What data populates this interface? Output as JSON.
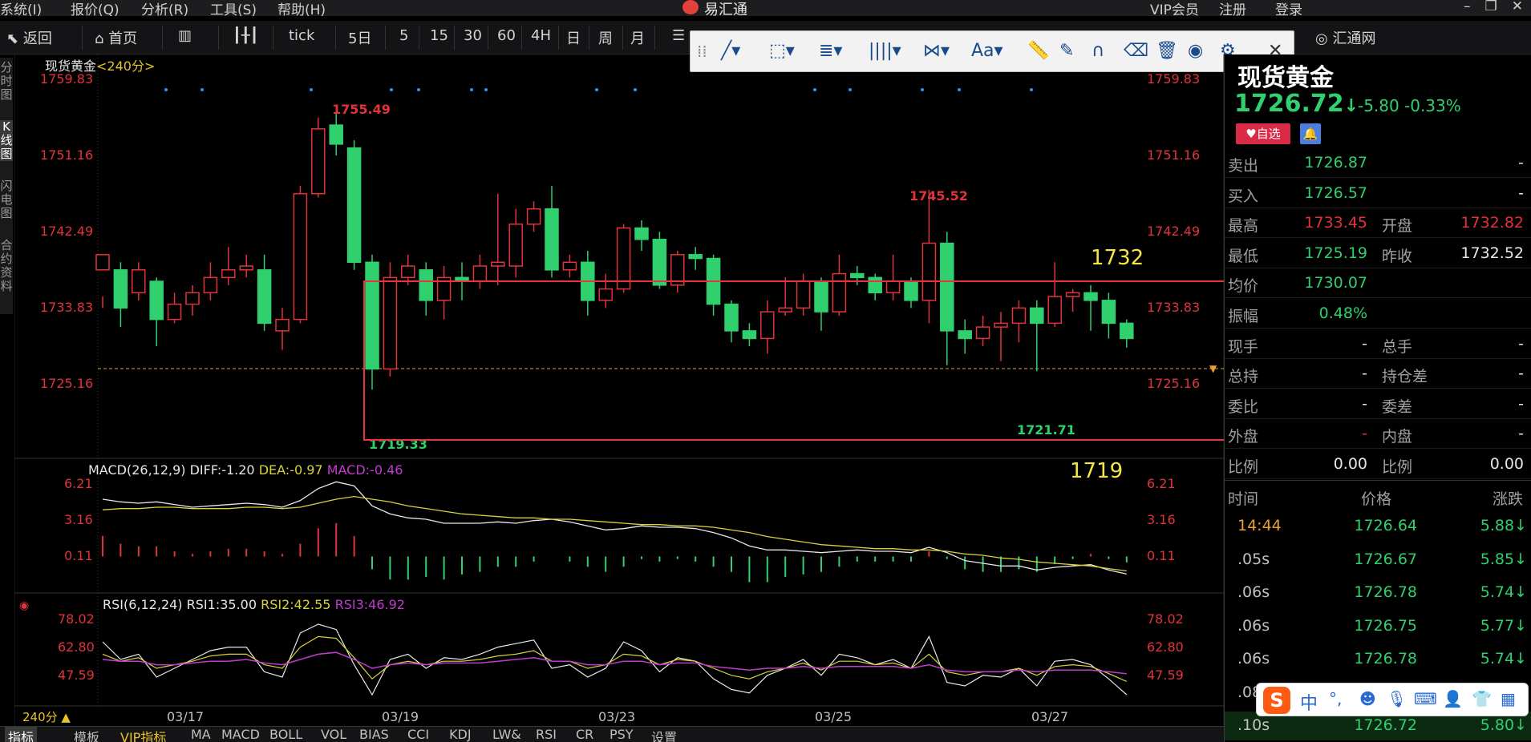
{
  "menubar": {
    "items": [
      "系统(I)",
      "报价(Q)",
      "分析(R)",
      "工具(S)",
      "帮助(H)"
    ],
    "app_title": "易汇通",
    "user_links": [
      "VIP会员",
      "注册",
      "登录"
    ]
  },
  "toolbar": {
    "back": "返回",
    "home": "首页",
    "tick": "tick",
    "periods": [
      "5日",
      "5",
      "15",
      "30",
      "60",
      "4H",
      "日",
      "周",
      "月"
    ],
    "brand": "汇通网"
  },
  "side_tabs": [
    "分时图",
    "K线图",
    "闪电图",
    "合约资料"
  ],
  "chart": {
    "instrument_label": "现货黄金",
    "period_label": "<240分>",
    "price_levels": [
      "1759.83",
      "1751.16",
      "1742.49",
      "1733.83",
      "1725.16"
    ],
    "annotations": {
      "high_label": "1755.49",
      "mid_high_label": "1745.52",
      "low_label": "1719.33",
      "low2_label": "1721.71",
      "note_upper": "1732",
      "note_lower": "1719"
    },
    "macd_header": {
      "title": "MACD(26,12,9)",
      "diff": "DIFF:-1.20",
      "dea": "DEA:-0.97",
      "macd": "MACD:-0.46"
    },
    "macd_levels": [
      "6.21",
      "3.16",
      "0.11"
    ],
    "rsi_header": {
      "title": "RSI(6,12,24)",
      "rsi1": "RSI1:35.00",
      "rsi2": "RSI2:42.55",
      "rsi3": "RSI3:46.92"
    },
    "rsi_levels": [
      "78.02",
      "62.80",
      "47.59"
    ],
    "date_labels": [
      "03/17",
      "03/19",
      "03/23",
      "03/25",
      "03/27"
    ],
    "period_badge": "240分 ▲",
    "colors": {
      "up": "#e0333a",
      "down": "#2fd06d",
      "diff_line": "#e8e8e8",
      "dea_line": "#d8d23a",
      "rsi3_line": "#c23ad0",
      "box": "#e8343f",
      "note": "#f5e642"
    }
  },
  "chart_data": {
    "type": "candlestick",
    "title": "现货黄金",
    "ylim": [
      1717,
      1762
    ],
    "candles": [
      [
        1735.0,
        1737.0,
        1731.5,
        1730.0
      ],
      [
        1735.0,
        1730.0,
        1736.0,
        1727.5
      ],
      [
        1732.0,
        1735.0,
        1736.0,
        1731.0
      ],
      [
        1733.5,
        1728.5,
        1734.0,
        1725.0
      ],
      [
        1728.5,
        1730.5,
        1732.0,
        1728.0
      ],
      [
        1730.5,
        1732.0,
        1733.0,
        1729.0
      ],
      [
        1732.0,
        1734.0,
        1736.0,
        1731.0
      ],
      [
        1734.0,
        1735.0,
        1738.0,
        1733.0
      ],
      [
        1735.0,
        1735.5,
        1737.0,
        1734.0
      ],
      [
        1735.0,
        1728.0,
        1737.0,
        1727.0
      ],
      [
        1727.0,
        1728.5,
        1730.0,
        1724.5
      ],
      [
        1728.5,
        1745.0,
        1746.0,
        1728.0
      ],
      [
        1745.0,
        1753.5,
        1755.0,
        1744.5
      ],
      [
        1754.0,
        1751.5,
        1755.5,
        1750.0
      ],
      [
        1751.0,
        1736.0,
        1752.0,
        1735.0
      ],
      [
        1736.0,
        1722.0,
        1737.0,
        1719.3
      ],
      [
        1722.0,
        1734.0,
        1736.0,
        1721.0
      ],
      [
        1734.0,
        1735.5,
        1737.0,
        1733.0
      ],
      [
        1735.0,
        1731.0,
        1736.0,
        1729.0
      ],
      [
        1731.0,
        1734.0,
        1735.5,
        1728.5
      ],
      [
        1734.0,
        1733.5,
        1736.0,
        1731.0
      ],
      [
        1733.5,
        1735.5,
        1737.0,
        1732.5
      ],
      [
        1735.5,
        1736.0,
        1745.0,
        1733.0
      ],
      [
        1735.5,
        1741.0,
        1743.0,
        1734.0
      ],
      [
        1741.0,
        1743.0,
        1744.0,
        1740.0
      ],
      [
        1743.0,
        1735.0,
        1746.0,
        1734.0
      ],
      [
        1735.0,
        1736.0,
        1737.0,
        1734.0
      ],
      [
        1736.0,
        1731.0,
        1737.5,
        1729.0
      ],
      [
        1731.0,
        1732.5,
        1734.5,
        1730.0
      ],
      [
        1732.5,
        1740.5,
        1741.0,
        1732.0
      ],
      [
        1740.5,
        1739.0,
        1741.5,
        1737.5
      ],
      [
        1739.0,
        1733.0,
        1740.0,
        1732.5
      ],
      [
        1733.0,
        1737.0,
        1737.5,
        1732.0
      ],
      [
        1737.0,
        1736.5,
        1738.0,
        1735.0
      ],
      [
        1736.5,
        1730.5,
        1737.0,
        1729.0
      ],
      [
        1730.5,
        1727.0,
        1731.0,
        1725.5
      ],
      [
        1727.0,
        1726.0,
        1728.0,
        1725.0
      ],
      [
        1726.0,
        1729.5,
        1731.0,
        1724.0
      ],
      [
        1729.5,
        1730.0,
        1734.0,
        1729.0
      ],
      [
        1730.0,
        1733.5,
        1734.5,
        1729.0
      ],
      [
        1733.5,
        1729.5,
        1734.0,
        1727.0
      ],
      [
        1729.5,
        1734.5,
        1737.0,
        1729.0
      ],
      [
        1734.5,
        1734.0,
        1735.5,
        1733.0
      ],
      [
        1734.0,
        1732.0,
        1734.5,
        1731.0
      ],
      [
        1732.0,
        1733.5,
        1737.0,
        1731.0
      ],
      [
        1733.5,
        1731.0,
        1734.0,
        1730.0
      ],
      [
        1731.0,
        1738.5,
        1745.5,
        1728.0
      ],
      [
        1738.5,
        1727.0,
        1740.0,
        1722.5
      ],
      [
        1727.0,
        1726.0,
        1728.5,
        1724.0
      ],
      [
        1726.0,
        1727.5,
        1729.0,
        1725.0
      ],
      [
        1727.5,
        1728.0,
        1729.5,
        1723.0
      ],
      [
        1728.0,
        1730.0,
        1731.0,
        1725.5
      ],
      [
        1730.0,
        1728.0,
        1731.0,
        1721.7
      ],
      [
        1728.0,
        1731.5,
        1736.0,
        1727.5
      ],
      [
        1731.5,
        1732.0,
        1732.5,
        1729.5
      ],
      [
        1732.0,
        1731.0,
        1733.0,
        1727.0
      ],
      [
        1731.0,
        1728.0,
        1732.0,
        1726.0
      ],
      [
        1728.0,
        1726.0,
        1728.5,
        1724.8
      ]
    ],
    "macd": {
      "diff": [
        4.4,
        4.2,
        4.1,
        4.2,
        4.0,
        3.8,
        3.9,
        4.0,
        4.1,
        4.0,
        3.8,
        4.3,
        5.2,
        5.7,
        5.4,
        3.9,
        3.3,
        3.0,
        2.9,
        2.6,
        2.6,
        2.6,
        2.7,
        2.6,
        2.8,
        2.9,
        2.7,
        2.4,
        2.1,
        2.2,
        2.4,
        2.3,
        2.3,
        2.2,
        1.9,
        1.5,
        0.9,
        0.6,
        0.6,
        0.5,
        0.4,
        0.5,
        0.6,
        0.5,
        0.5,
        0.4,
        0.8,
        0.4,
        -0.2,
        -0.4,
        -0.6,
        -0.6,
        -0.9,
        -0.7,
        -0.6,
        -0.5,
        -0.9,
        -1.2
      ],
      "dea": [
        3.6,
        3.7,
        3.7,
        3.8,
        3.8,
        3.7,
        3.7,
        3.7,
        3.8,
        3.8,
        3.7,
        3.8,
        4.1,
        4.4,
        4.6,
        4.4,
        4.2,
        3.9,
        3.7,
        3.5,
        3.3,
        3.2,
        3.1,
        3.0,
        3.0,
        2.9,
        2.9,
        2.8,
        2.7,
        2.6,
        2.5,
        2.5,
        2.4,
        2.4,
        2.3,
        2.1,
        1.9,
        1.6,
        1.4,
        1.2,
        1.0,
        0.9,
        0.8,
        0.7,
        0.7,
        0.6,
        0.6,
        0.5,
        0.3,
        0.2,
        0.0,
        -0.1,
        -0.3,
        -0.4,
        -0.5,
        -0.6,
        -0.8,
        -0.97
      ]
    },
    "rsi": {
      "rsi1": [
        65,
        55,
        58,
        45,
        50,
        55,
        60,
        62,
        62,
        48,
        45,
        70,
        75,
        72,
        52,
        35,
        55,
        58,
        50,
        56,
        55,
        58,
        62,
        64,
        66,
        50,
        52,
        45,
        50,
        65,
        60,
        48,
        56,
        54,
        44,
        38,
        36,
        46,
        50,
        55,
        46,
        58,
        56,
        52,
        55,
        50,
        68,
        42,
        40,
        46,
        45,
        50,
        40,
        54,
        55,
        52,
        44,
        35
      ],
      "rsi2": [
        58,
        54,
        56,
        50,
        52,
        54,
        57,
        58,
        58,
        52,
        50,
        62,
        68,
        67,
        56,
        44,
        52,
        54,
        52,
        54,
        54,
        55,
        57,
        58,
        60,
        54,
        54,
        50,
        52,
        58,
        57,
        52,
        55,
        54,
        50,
        46,
        44,
        48,
        50,
        53,
        49,
        54,
        54,
        52,
        53,
        50,
        58,
        48,
        46,
        48,
        48,
        50,
        46,
        51,
        52,
        51,
        47,
        42.55
      ],
      "rsi3": [
        55,
        54,
        54,
        52,
        52,
        53,
        54,
        54,
        55,
        53,
        52,
        55,
        58,
        59,
        55,
        50,
        52,
        53,
        52,
        53,
        53,
        53,
        54,
        55,
        56,
        54,
        54,
        52,
        52,
        54,
        54,
        52,
        53,
        53,
        51,
        50,
        49,
        50,
        50,
        51,
        50,
        51,
        51,
        51,
        51,
        50,
        52,
        49,
        48,
        48,
        48,
        49,
        48,
        49,
        49,
        49,
        48,
        46.92
      ]
    }
  },
  "right_panel": {
    "title": "现货黄金",
    "price": "1726.72",
    "arrow": "↓",
    "change": "-5.80",
    "change_pct": "-0.33%",
    "watch_btn": "自选",
    "rows": [
      {
        "l": "卖出",
        "v": "1726.87",
        "l2": "",
        "v2": "-"
      },
      {
        "l": "买入",
        "v": "1726.57",
        "l2": "",
        "v2": "-"
      },
      {
        "l": "最高",
        "v": "1733.45",
        "l2": "开盘",
        "v2": "1732.82"
      },
      {
        "l": "最低",
        "v": "1725.19",
        "l2": "昨收",
        "v2": "1732.52"
      },
      {
        "l": "均价",
        "v": "1730.07",
        "l2": "",
        "v2": ""
      },
      {
        "l": "振幅",
        "v": "0.48%",
        "l2": "",
        "v2": ""
      },
      {
        "l": "现手",
        "v": "-",
        "l2": "总手",
        "v2": "-"
      },
      {
        "l": "总持",
        "v": "-",
        "l2": "持仓差",
        "v2": "-"
      },
      {
        "l": "委比",
        "v": "-",
        "l2": "委差",
        "v2": "-"
      },
      {
        "l": "外盘",
        "v": "-",
        "l2": "内盘",
        "v2": "-"
      },
      {
        "l": "比例",
        "v": "0.00",
        "l2": "比例",
        "v2": "0.00"
      }
    ],
    "tick_header": [
      "时间",
      "价格",
      "涨跌"
    ],
    "ticks": [
      {
        "t": "14:44",
        "p": "1726.64",
        "c": "5.88↓"
      },
      {
        "t": ".05s",
        "p": "1726.67",
        "c": "5.85↓"
      },
      {
        "t": ".06s",
        "p": "1726.78",
        "c": "5.74↓"
      },
      {
        "t": ".06s",
        "p": "1726.75",
        "c": "5.77↓"
      },
      {
        "t": ".06s",
        "p": "1726.78",
        "c": "5.74↓"
      },
      {
        "t": ".08",
        "p": "",
        "c": ""
      },
      {
        "t": ".10s",
        "p": "1726.72",
        "c": "5.80↓"
      }
    ]
  },
  "bottom_tabs": [
    "指标",
    "模板",
    "VIP指标",
    "MA",
    "MACD",
    "BOLL",
    "VOL",
    "BIAS",
    "CCI",
    "KDJ",
    "LW&",
    "RSI",
    "CR",
    "PSY",
    "设置"
  ],
  "ime": {
    "items": [
      "中",
      "°,"
    ]
  }
}
